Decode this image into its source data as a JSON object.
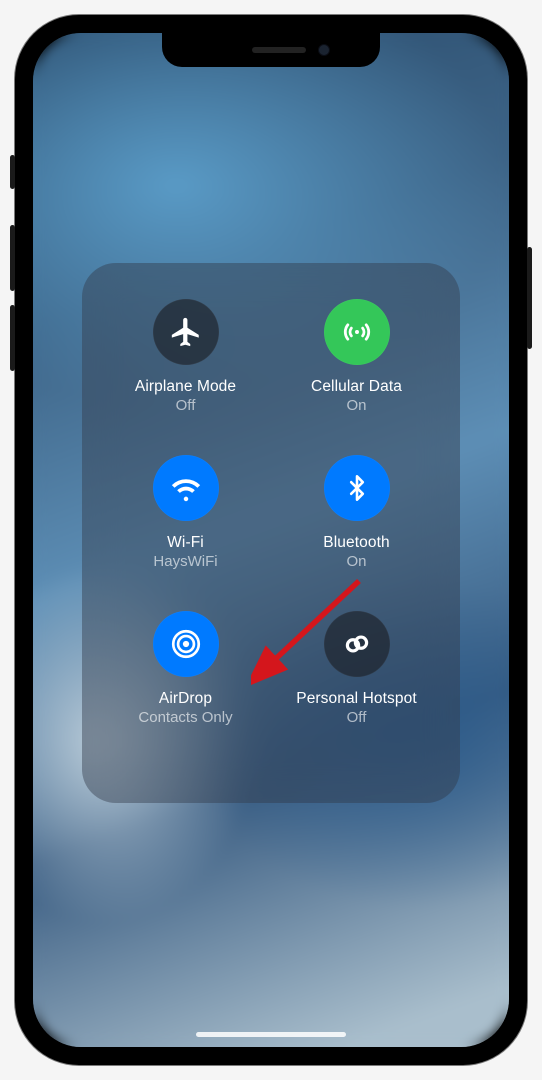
{
  "controls": {
    "airplane": {
      "label": "Airplane Mode",
      "status": "Off"
    },
    "cellular": {
      "label": "Cellular Data",
      "status": "On"
    },
    "wifi": {
      "label": "Wi-Fi",
      "status": "HaysWiFi"
    },
    "bluetooth": {
      "label": "Bluetooth",
      "status": "On"
    },
    "airdrop": {
      "label": "AirDrop",
      "status": "Contacts Only"
    },
    "hotspot": {
      "label": "Personal Hotspot",
      "status": "Off"
    }
  },
  "colors": {
    "blue": "#007aff",
    "green": "#34c759",
    "off": "rgba(28,32,40,0.65)"
  }
}
